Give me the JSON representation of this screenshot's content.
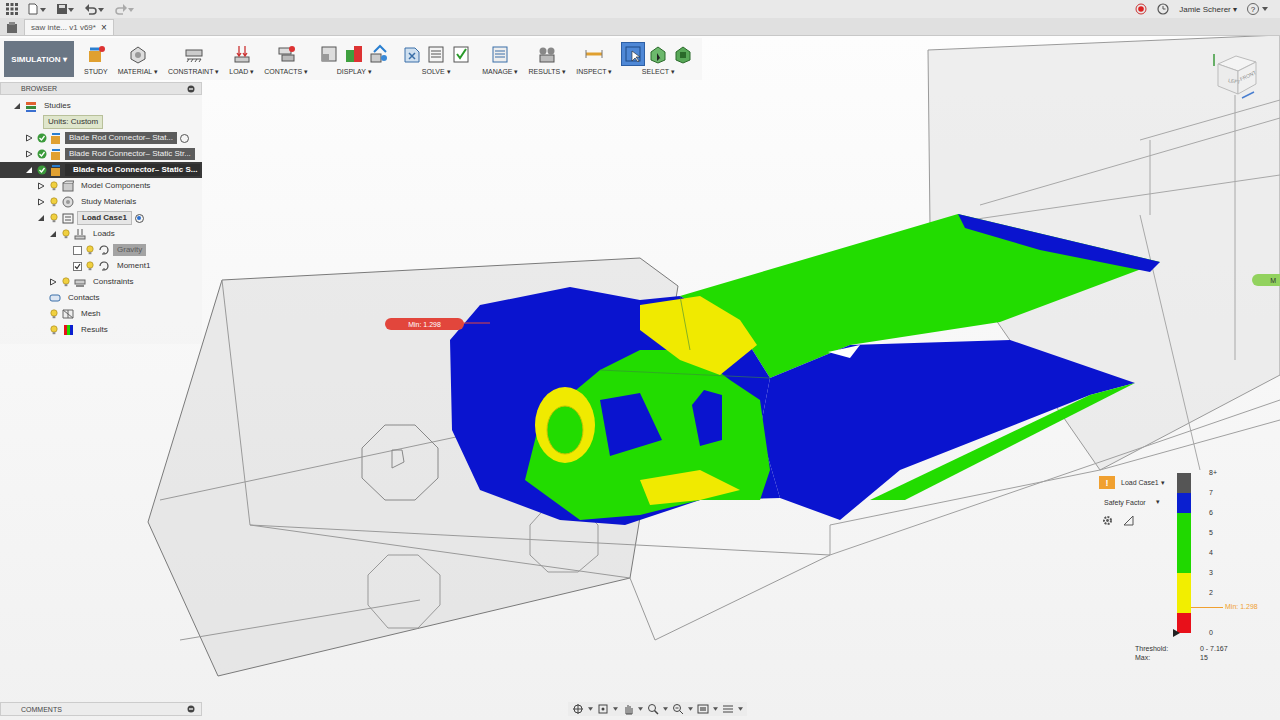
{
  "app_bar": {
    "file_tab": "saw inte... v1 v69*",
    "close": "×",
    "user": "Jamie Scherer ▾",
    "help": "?"
  },
  "toolbar": {
    "workspace": "SIMULATION ▾",
    "groups": [
      {
        "label": "STUDY",
        "selected": false
      },
      {
        "label": "MATERIAL ▾",
        "selected": false
      },
      {
        "label": "CONSTRAINT ▾",
        "selected": false
      },
      {
        "label": "LOAD ▾",
        "selected": false
      },
      {
        "label": "CONTACTS ▾",
        "selected": false
      },
      {
        "label": "DISPLAY ▾",
        "selected": false
      },
      {
        "label": "SOLVE ▾",
        "selected": false
      },
      {
        "label": "MANAGE ▾",
        "selected": false
      },
      {
        "label": "RESULTS ▾",
        "selected": false
      },
      {
        "label": "INSPECT ▾",
        "selected": false
      },
      {
        "label": "SELECT ▾",
        "selected": true
      }
    ]
  },
  "browser": {
    "title": "BROWSER",
    "items": [
      {
        "label": "Studies",
        "depth": 0,
        "kind": "studies",
        "expanded": true,
        "selected": false
      },
      {
        "label": "Units: Custom",
        "depth": 1,
        "kind": "units",
        "selected": false
      },
      {
        "label": "Blade Rod Connector– Stat...",
        "depth": 1,
        "kind": "study",
        "expanded": false,
        "selected": false,
        "radio_on": false
      },
      {
        "label": "Blade Rod Connector– Static Str...",
        "depth": 1,
        "kind": "study",
        "expanded": false,
        "selected": false
      },
      {
        "label": "Blade Rod Connector– Static S...",
        "depth": 1,
        "kind": "study",
        "expanded": true,
        "selected": true
      },
      {
        "label": "Model Components",
        "depth": 2,
        "kind": "components",
        "expanded": false,
        "selected": false
      },
      {
        "label": "Study Materials",
        "depth": 2,
        "kind": "materials",
        "expanded": false,
        "selected": false
      },
      {
        "label": "Load Case1",
        "depth": 2,
        "kind": "loadcase",
        "expanded": true,
        "selected": false,
        "radio_on": true
      },
      {
        "label": "Loads",
        "depth": 3,
        "kind": "loads",
        "expanded": true,
        "selected": false
      },
      {
        "label": "Gravity",
        "depth": 4,
        "kind": "load",
        "selected": false,
        "checked": false,
        "disabled": true
      },
      {
        "label": "Moment1",
        "depth": 4,
        "kind": "load",
        "selected": false,
        "checked": true,
        "disabled": false
      },
      {
        "label": "Constraints",
        "depth": 3,
        "kind": "constraints",
        "expanded": false,
        "selected": false
      },
      {
        "label": "Contacts",
        "depth": 2,
        "kind": "contacts",
        "selected": false
      },
      {
        "label": "Mesh",
        "depth": 2,
        "kind": "mesh",
        "selected": false
      },
      {
        "label": "Results",
        "depth": 2,
        "kind": "results",
        "selected": false
      }
    ]
  },
  "viewport": {
    "min_marker": "Min: 1.298",
    "max_marker": "M",
    "viewcube": {
      "left": "LEFT",
      "front": "FRONT"
    }
  },
  "legend": {
    "warning": "!",
    "load_case": "Load Case1 ▾",
    "result_type": "Safety Factor",
    "result_caret": "▾",
    "ticks": [
      {
        "label": "8+",
        "value": 8
      },
      {
        "label": "7",
        "value": 7
      },
      {
        "label": "6",
        "value": 6
      },
      {
        "label": "5",
        "value": 5
      },
      {
        "label": "4",
        "value": 4
      },
      {
        "label": "3",
        "value": 3
      },
      {
        "label": "2",
        "value": 2
      },
      {
        "label": "0",
        "value": 0
      }
    ],
    "bands": [
      {
        "from": 0,
        "to": 1,
        "color": "#e8101a"
      },
      {
        "from": 1,
        "to": 3,
        "color": "#f2ee00"
      },
      {
        "from": 3,
        "to": 6,
        "color": "#20d800"
      },
      {
        "from": 6,
        "to": 7,
        "color": "#0a1fd0"
      },
      {
        "from": 7,
        "to": 8,
        "color": "#555555"
      }
    ],
    "min_label": "Min: 1.298",
    "min_value": 1.298,
    "threshold_label": "Threshold:",
    "threshold_value": "0 - 7.167",
    "max_label": "Max:",
    "max_value": "15"
  },
  "comments": {
    "title": "COMMENTS"
  }
}
